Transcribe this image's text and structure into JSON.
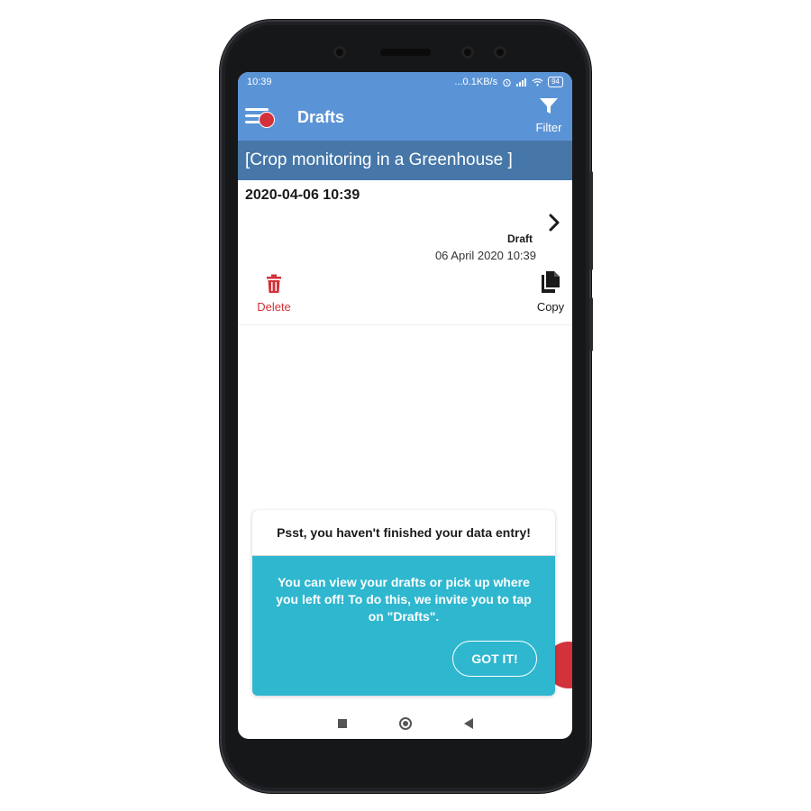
{
  "status_bar": {
    "time": "10:39",
    "net_speed": "...0.1KB/s",
    "battery": "94"
  },
  "app_bar": {
    "title": "Drafts",
    "filter_label": "Filter"
  },
  "project": {
    "title": "[Crop monitoring in a Greenhouse ]"
  },
  "draft": {
    "datetime": "2020-04-06 10:39",
    "status": "Draft",
    "date": "06 April 2020 10:39",
    "delete_label": "Delete",
    "copy_label": "Copy"
  },
  "tooltip": {
    "title": "Psst, you haven't finished your data entry!",
    "message": "You can view your drafts or pick up where you left off! To do this, we invite you to tap on \"Drafts\".",
    "button": "GOT IT!"
  },
  "icons": {
    "menu": "menu-icon",
    "filter": "filter-icon",
    "chevron": "chevron-right-icon",
    "delete": "trash-icon",
    "copy": "copy-icon"
  },
  "colors": {
    "primary": "#5b94d6",
    "project_bar": "#4677a8",
    "accent_red": "#d3323b",
    "tooltip": "#2fb7cf"
  }
}
